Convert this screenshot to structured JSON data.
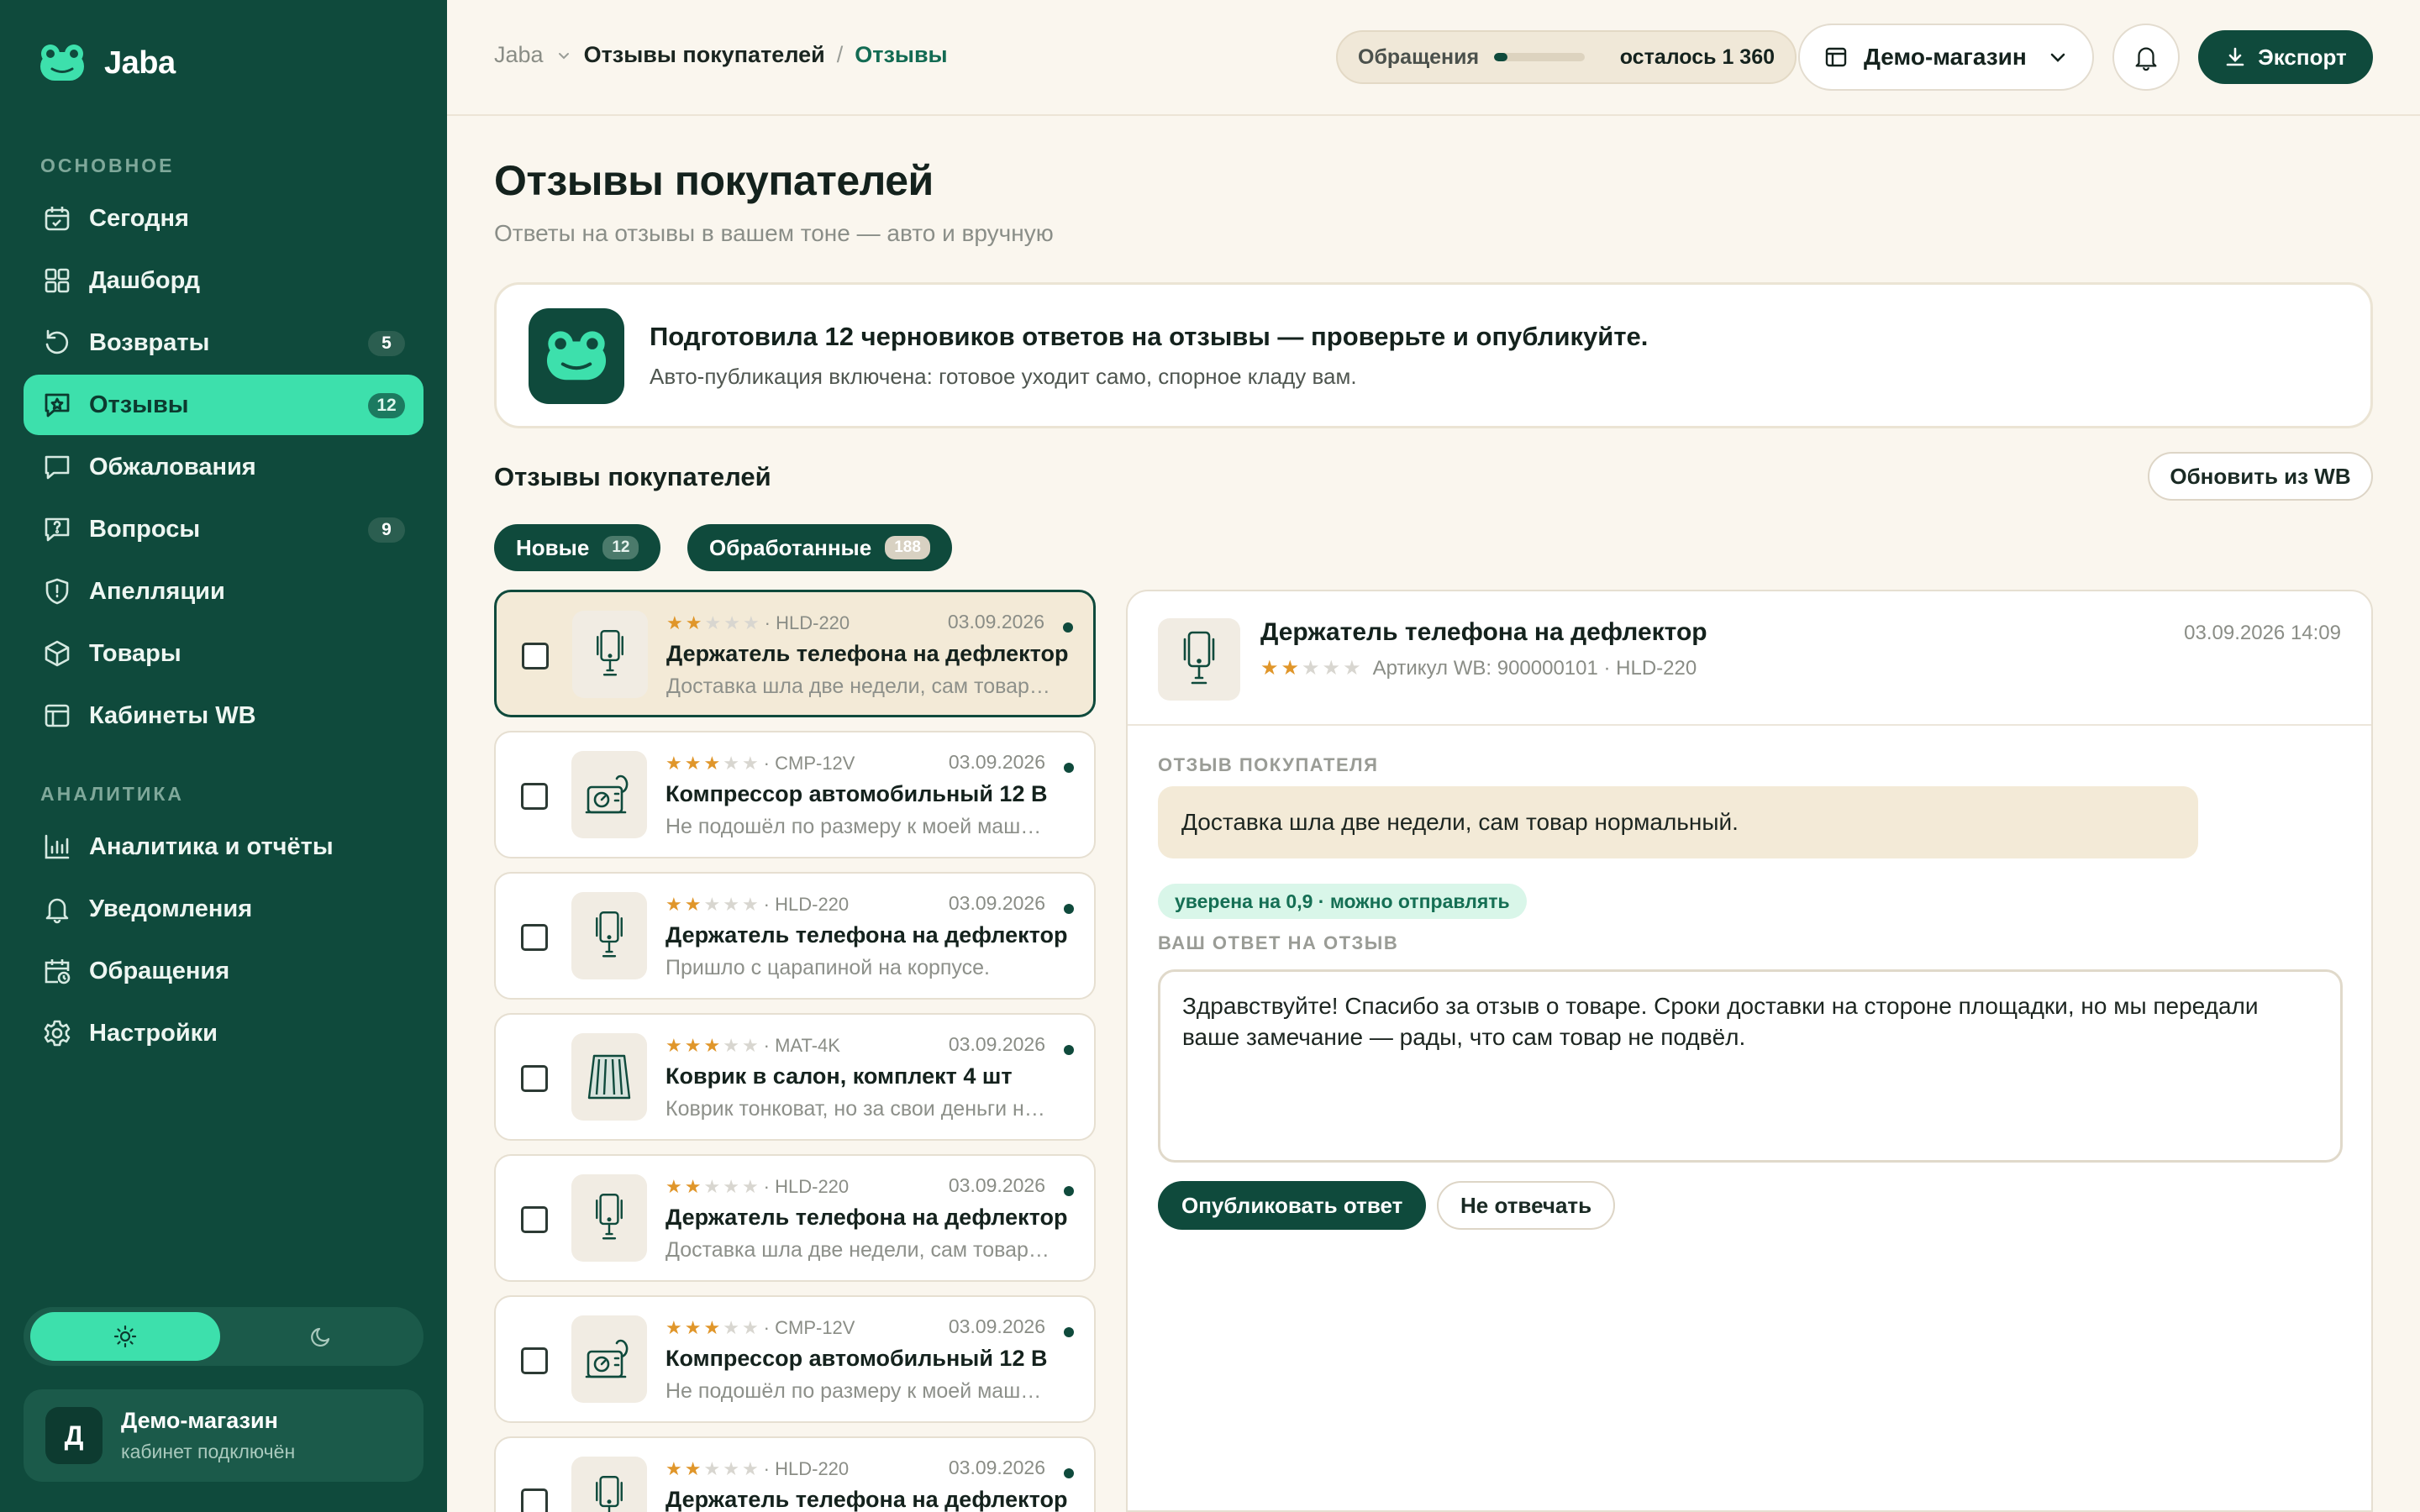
{
  "brand": {
    "name": "Jaba"
  },
  "sidebar": {
    "section_main": "ОСНОВНОЕ",
    "section_analytics": "АНАЛИТИКА",
    "items": [
      {
        "label": "Сегодня",
        "icon": "calendar-icon"
      },
      {
        "label": "Дашборд",
        "icon": "grid-icon"
      },
      {
        "label": "Возвраты",
        "icon": "return-icon",
        "badge": "5"
      },
      {
        "label": "Отзывы",
        "icon": "review-icon",
        "badge": "12",
        "active": true
      },
      {
        "label": "Обжалования",
        "icon": "message-icon"
      },
      {
        "label": "Вопросы",
        "icon": "question-icon",
        "badge": "9"
      },
      {
        "label": "Апелляции",
        "icon": "shield-icon"
      },
      {
        "label": "Товары",
        "icon": "box-icon"
      },
      {
        "label": "Кабинеты WB",
        "icon": "table-icon"
      }
    ],
    "analytics_items": [
      {
        "label": "Аналитика и отчёты",
        "icon": "chart-icon"
      },
      {
        "label": "Уведомления",
        "icon": "bell-icon"
      },
      {
        "label": "Обращения",
        "icon": "calendar-clock-icon"
      },
      {
        "label": "Настройки",
        "icon": "gear-icon"
      }
    ],
    "account": {
      "avatar_letter": "Д",
      "name": "Демо-магазин",
      "status": "кабинет подключён"
    }
  },
  "topbar": {
    "breadcrumb": {
      "root": "Jaba",
      "section": "Отзывы покупателей",
      "separator": "/",
      "current": "Отзывы"
    },
    "quota": {
      "label": "Обращения",
      "remaining": "осталось 1 360",
      "fill_fraction": 0.15
    },
    "shop": "Демо-магазин",
    "export_label": "Экспорт"
  },
  "page": {
    "title": "Отзывы покупателей",
    "subtitle": "Ответы на отзывы в вашем тоне — авто и вручную"
  },
  "banner": {
    "title": "Подготовила 12 черновиков ответов на отзывы — проверьте и опубликуйте.",
    "text": "Авто-публикация включена: готовое уходит само, спорное кладу вам."
  },
  "reviews_section": {
    "title": "Отзывы покупателей",
    "refresh_label": "Обновить из WB",
    "tabs": [
      {
        "label": "Новые",
        "count": "12"
      },
      {
        "label": "Обработанные",
        "count": "188"
      }
    ]
  },
  "reviews": [
    {
      "stars": 2,
      "sku": "· HLD-220",
      "date": "03.09.2026",
      "title": "Держатель телефона на дефлектор",
      "snippet": "Доставка шла две недели, сам товар нормальный.",
      "thumb": "phone-holder-icon",
      "selected": true
    },
    {
      "stars": 3,
      "sku": "· CMP-12V",
      "date": "03.09.2026",
      "title": "Компрессор автомобильный 12 В",
      "snippet": "Не подошёл по размеру к моей машине.",
      "thumb": "compressor-icon"
    },
    {
      "stars": 2,
      "sku": "· HLD-220",
      "date": "03.09.2026",
      "title": "Держатель телефона на дефлектор",
      "snippet": "Пришло с царапиной на корпусе.",
      "thumb": "phone-holder-icon"
    },
    {
      "stars": 3,
      "sku": "· MAT-4K",
      "date": "03.09.2026",
      "title": "Коврик в салон, комплект 4 шт",
      "snippet": "Коврик тонковат, но за свои деньги нормально.",
      "thumb": "car-mat-icon"
    },
    {
      "stars": 2,
      "sku": "· HLD-220",
      "date": "03.09.2026",
      "title": "Держатель телефона на дефлектор",
      "snippet": "Доставка шла две недели, сам товар нормальный.",
      "thumb": "phone-holder-icon"
    },
    {
      "stars": 3,
      "sku": "· CMP-12V",
      "date": "03.09.2026",
      "title": "Компрессор автомобильный 12 В",
      "snippet": "Не подошёл по размеру к моей машине.",
      "thumb": "compressor-icon"
    },
    {
      "stars": 2,
      "sku": "· HLD-220",
      "date": "03.09.2026",
      "title": "Держатель телефона на дефлектор",
      "snippet": "",
      "thumb": "phone-holder-icon"
    }
  ],
  "detail": {
    "title": "Держатель телефона на дефлектор",
    "stars": 2,
    "meta": "Артикул WB: 900000101 · HLD-220",
    "date": "03.09.2026 14:09",
    "review_label": "ОТЗЫВ ПОКУПАТЕЛЯ",
    "review_text": "Доставка шла две недели, сам товар нормальный.",
    "confidence": "уверена на 0,9 · можно отправлять",
    "answer_label": "ВАШ ОТВЕТ НА ОТЗЫВ",
    "answer_text": "Здравствуйте! Спасибо за отзыв о товаре. Сроки доставки на стороне площадки, но мы передали ваше замечание — рады, что сам товар не подвёл.",
    "publish_label": "Опубликовать ответ",
    "skip_label": "Не отвечать"
  },
  "colors": {
    "sidebar": "#0f4a3c",
    "accent": "#3de0ac",
    "star": "#e0962a",
    "background": "#faf6ee"
  }
}
